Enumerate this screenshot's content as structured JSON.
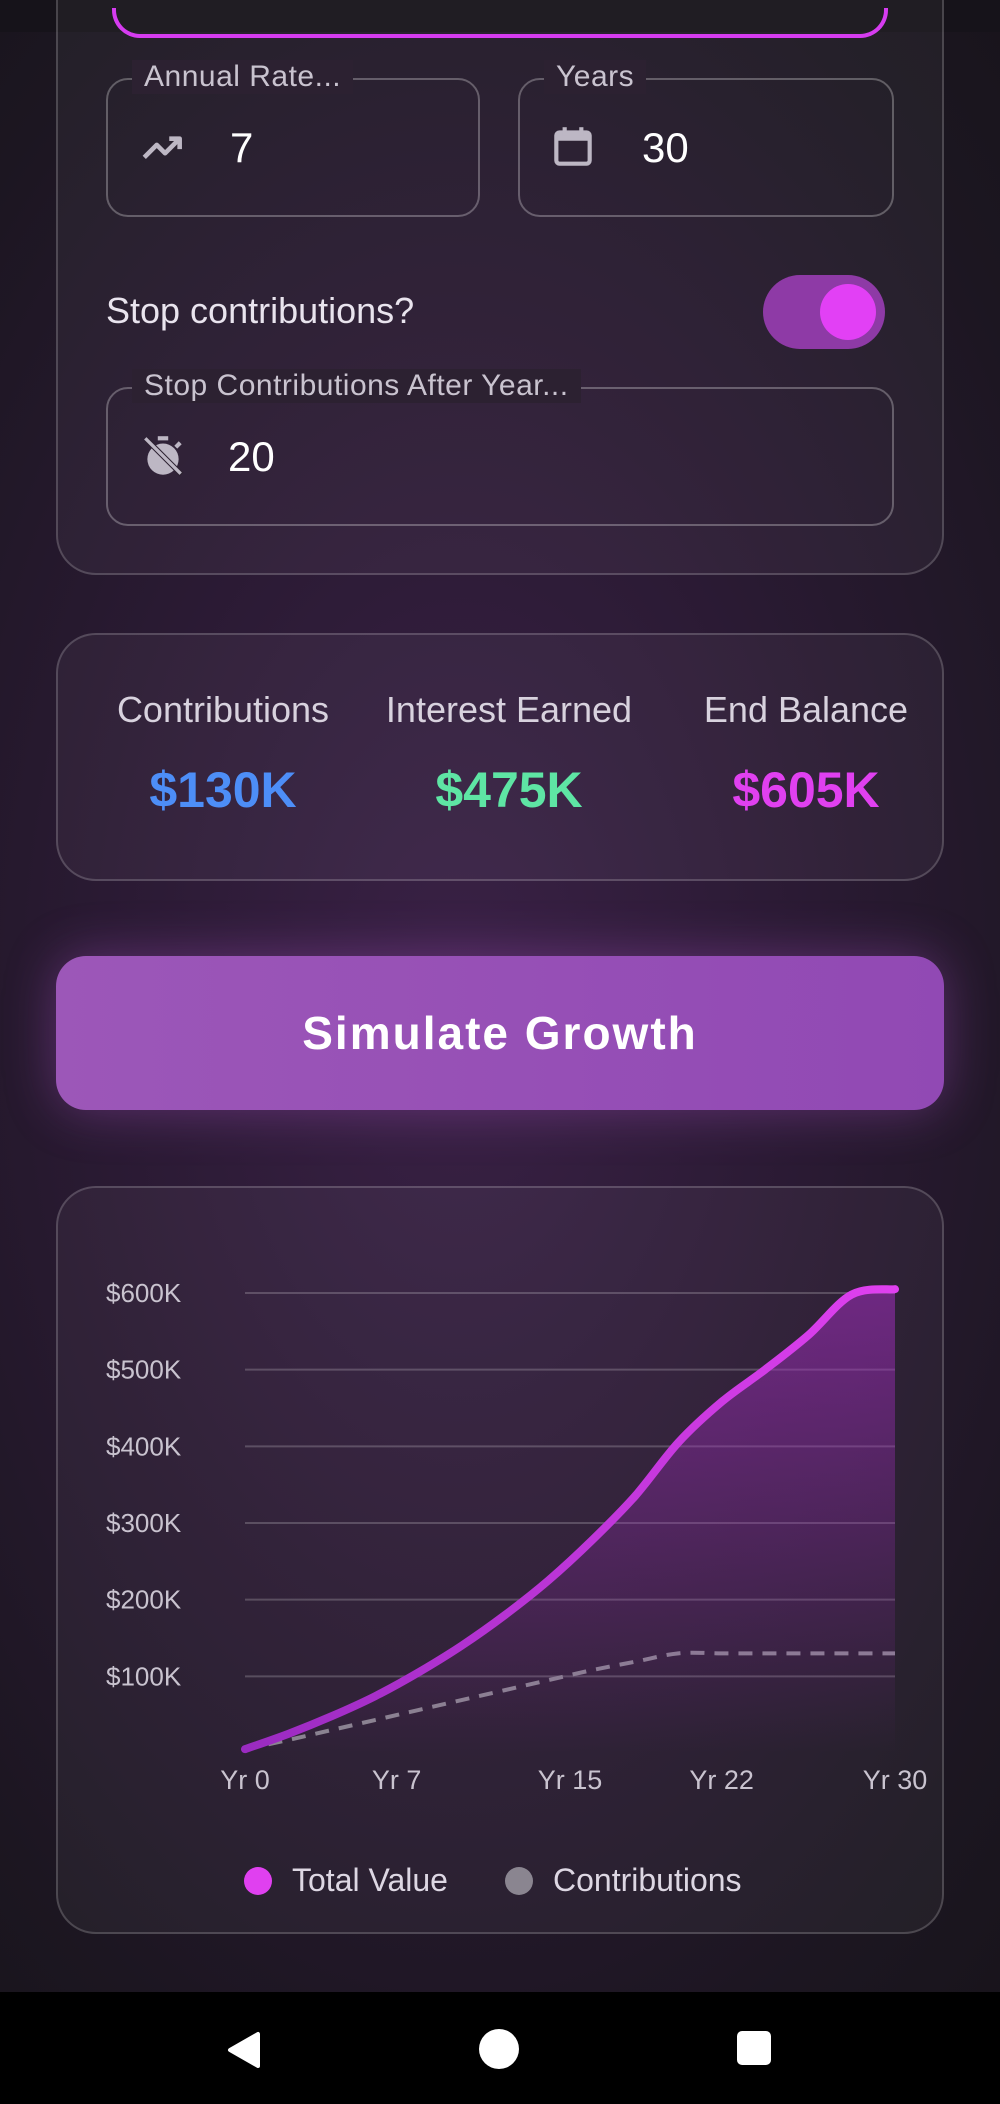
{
  "inputs": {
    "annual_rate": {
      "label": "Annual Rate...",
      "value": "7",
      "icon": "trending-up-icon"
    },
    "years": {
      "label": "Years",
      "value": "30",
      "icon": "calendar-icon"
    },
    "stop_toggle": {
      "label": "Stop contributions?",
      "on": true
    },
    "stop_after": {
      "label": "Stop Contributions After Year...",
      "value": "20",
      "icon": "timer-off-icon"
    }
  },
  "summary": {
    "contributions": {
      "label": "Contributions",
      "value": "$130K",
      "color": "#4d8ef7"
    },
    "interest": {
      "label": "Interest Earned",
      "value": "$475K",
      "color": "#5ee5a4"
    },
    "end_balance": {
      "label": "End Balance",
      "value": "$605K",
      "color": "#e040f0"
    }
  },
  "simulate_button": {
    "label": "Simulate Growth"
  },
  "chart_data": {
    "type": "line",
    "x": [
      0,
      2,
      4,
      6,
      8,
      10,
      12,
      14,
      16,
      18,
      20,
      22,
      24,
      26,
      28,
      30
    ],
    "x_ticks": [
      0,
      7,
      15,
      22,
      30
    ],
    "x_tick_labels": [
      "Yr 0",
      "Yr 7",
      "Yr 15",
      "Yr 22",
      "Yr 30"
    ],
    "y_ticks": [
      100,
      200,
      300,
      400,
      500,
      600
    ],
    "y_tick_labels": [
      "$100K",
      "$200K",
      "$300K",
      "$400K",
      "$500K",
      "$600K"
    ],
    "ylim": [
      0,
      600
    ],
    "xlim": [
      0,
      30
    ],
    "grid": true,
    "legend_placement": "bottom-center",
    "series": [
      {
        "name": "Total Value",
        "color": "#e040f0",
        "style": "solid-area",
        "values": [
          5,
          25,
          48,
          74,
          105,
          140,
          180,
          225,
          277,
          335,
          405,
          458,
          500,
          545,
          598,
          605
        ]
      },
      {
        "name": "Contributions",
        "color": "#8a8590",
        "style": "dashed",
        "values": [
          5,
          17,
          30,
          43,
          56,
          69,
          82,
          95,
          108,
          119,
          130,
          130,
          130,
          130,
          130,
          130
        ]
      }
    ]
  }
}
